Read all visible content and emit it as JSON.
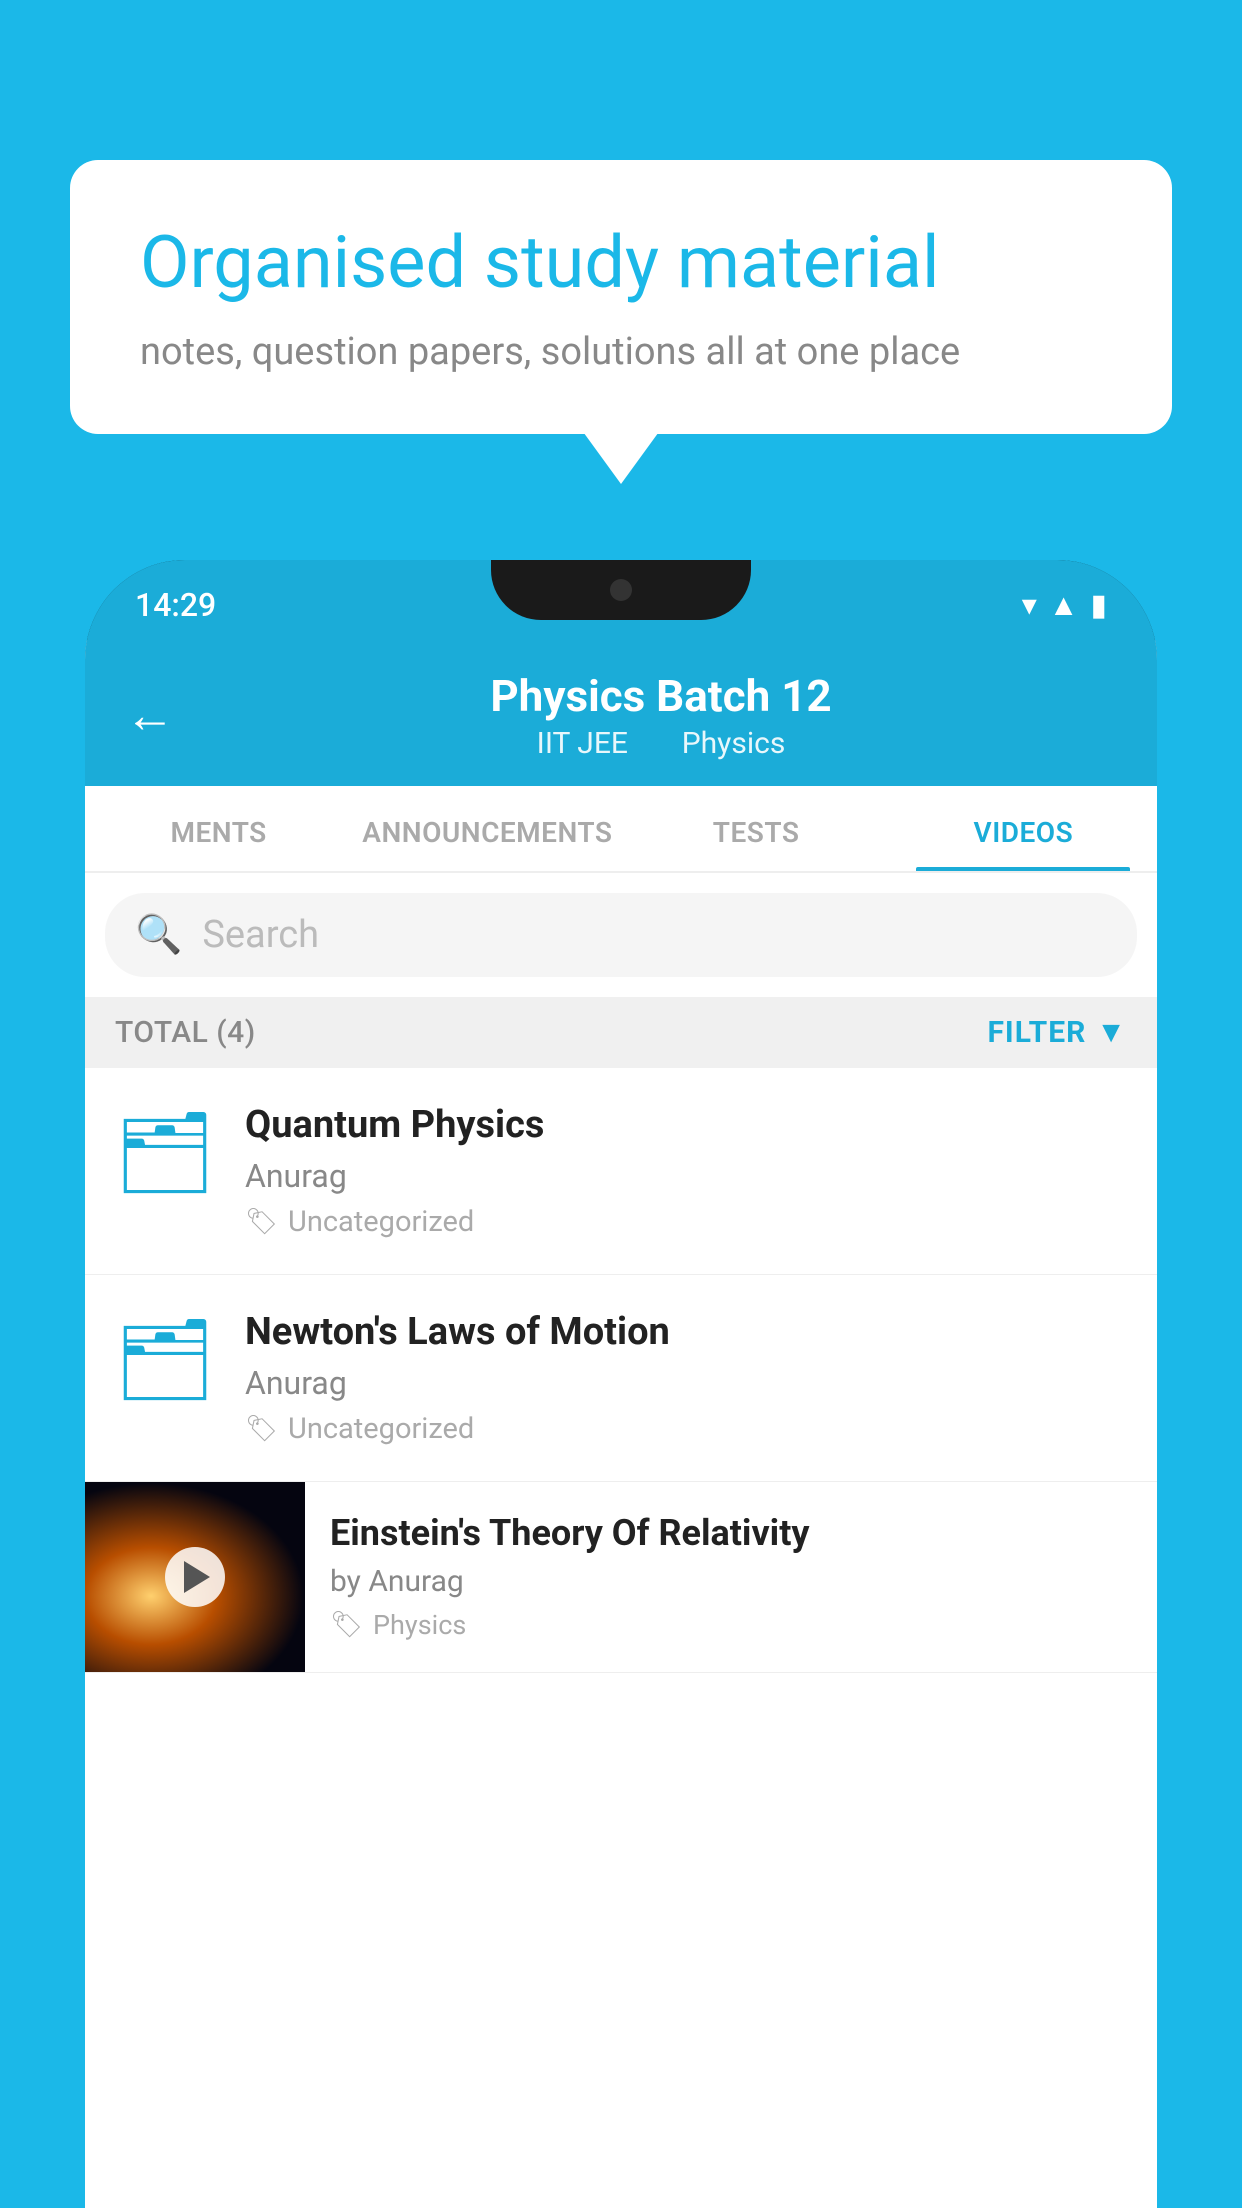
{
  "background_color": "#1bb8e8",
  "speech_bubble": {
    "heading": "Organised study material",
    "subtext": "notes, question papers, solutions all at one place"
  },
  "phone": {
    "status_bar": {
      "time": "14:29",
      "icons": [
        "wifi",
        "signal",
        "battery"
      ]
    },
    "header": {
      "back_label": "←",
      "title": "Physics Batch 12",
      "subtitle_part1": "IIT JEE",
      "subtitle_part2": "Physics"
    },
    "tabs": [
      {
        "label": "MENTS",
        "active": false
      },
      {
        "label": "ANNOUNCEMENTS",
        "active": false
      },
      {
        "label": "TESTS",
        "active": false
      },
      {
        "label": "VIDEOS",
        "active": true
      }
    ],
    "search": {
      "placeholder": "Search"
    },
    "filter_bar": {
      "total_label": "TOTAL (4)",
      "filter_label": "FILTER"
    },
    "videos": [
      {
        "id": 1,
        "title": "Quantum Physics",
        "author": "Anurag",
        "tag": "Uncategorized",
        "type": "folder"
      },
      {
        "id": 2,
        "title": "Newton's Laws of Motion",
        "author": "Anurag",
        "tag": "Uncategorized",
        "type": "folder"
      },
      {
        "id": 3,
        "title": "Einstein's Theory Of Relativity",
        "author": "by Anurag",
        "tag": "Physics",
        "type": "video"
      }
    ]
  }
}
